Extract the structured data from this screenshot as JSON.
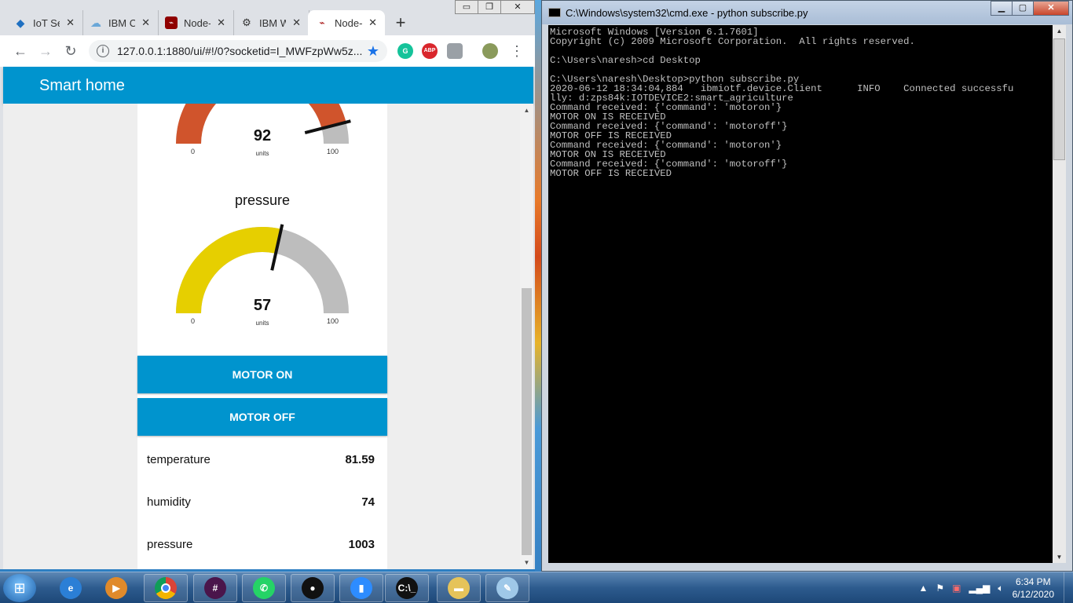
{
  "chrome": {
    "tabs": [
      {
        "label": "IoT Se",
        "icon": "iot-diamond-icon",
        "active": false
      },
      {
        "label": "IBM C",
        "icon": "cloud-icon",
        "active": false
      },
      {
        "label": "Node-",
        "icon": "node-red-icon",
        "active": false
      },
      {
        "label": "IBM W",
        "icon": "watson-icon",
        "active": false
      },
      {
        "label": "Node-",
        "icon": "node-red-icon",
        "active": true
      }
    ],
    "new_tab": "+",
    "close_glyph": "✕",
    "url": "127.0.0.1:1880/ui/#!/0?socketid=I_MWFzpWw5z...",
    "extensions": [
      "G",
      "ABP"
    ]
  },
  "dashboard": {
    "title": "Smart home",
    "gauge_top": {
      "value": "92",
      "units": "units",
      "min": "0",
      "max": "100",
      "level": 92,
      "color": "#d0542c"
    },
    "gauge_pressure": {
      "title": "pressure",
      "value": "57",
      "units": "units",
      "min": "0",
      "max": "100",
      "level": 57,
      "color": "#e6cf00"
    },
    "buttons": {
      "motor_on": "MOTOR ON",
      "motor_off": "MOTOR OFF"
    },
    "readings": [
      {
        "label": "temperature",
        "value": "81.59"
      },
      {
        "label": "humidity",
        "value": "74"
      },
      {
        "label": "pressure",
        "value": "1003"
      }
    ]
  },
  "cmd": {
    "title": "C:\\Windows\\system32\\cmd.exe - python  subscribe.py",
    "lines": [
      "Microsoft Windows [Version 6.1.7601]",
      "Copyright (c) 2009 Microsoft Corporation.  All rights reserved.",
      "",
      "C:\\Users\\naresh>cd Desktop",
      "",
      "C:\\Users\\naresh\\Desktop>python subscribe.py",
      "2020-06-12 18:34:04,884   ibmiotf.device.Client      INFO    Connected successfu",
      "lly: d:zps84k:IOTDEVICE2:smart_agriculture",
      "Command received: {'command': 'motoron'}",
      "MOTOR ON IS RECEIVED",
      "Command received: {'command': 'motoroff'}",
      "MOTOR OFF IS RECEIVED",
      "Command received: {'command': 'motoron'}",
      "MOTOR ON IS RECEIVED",
      "Command received: {'command': 'motoroff'}",
      "MOTOR OFF IS RECEIVED"
    ]
  },
  "taskbar": {
    "time": "6:34 PM",
    "date": "6/12/2020",
    "apps": [
      {
        "name": "ie-icon",
        "label": "e",
        "color": "#2b7fd6"
      },
      {
        "name": "media-player-icon",
        "label": "▶",
        "color": "#e08a2b"
      },
      {
        "name": "chrome-icon",
        "label": "",
        "color": "#db4437"
      },
      {
        "name": "slack-icon",
        "label": "#",
        "color": "#4a154b"
      },
      {
        "name": "whatsapp-icon",
        "label": "✆",
        "color": "#25d366"
      },
      {
        "name": "recorder-icon",
        "label": "●",
        "color": "#111111"
      },
      {
        "name": "zoom-icon",
        "label": "▮",
        "color": "#2d8cff"
      },
      {
        "name": "cmd-icon",
        "label": "C:\\_",
        "color": "#111111"
      },
      {
        "name": "explorer-icon",
        "label": "▬",
        "color": "#e5c35a"
      },
      {
        "name": "notepad-icon",
        "label": "✎",
        "color": "#9fc8e8"
      }
    ]
  }
}
